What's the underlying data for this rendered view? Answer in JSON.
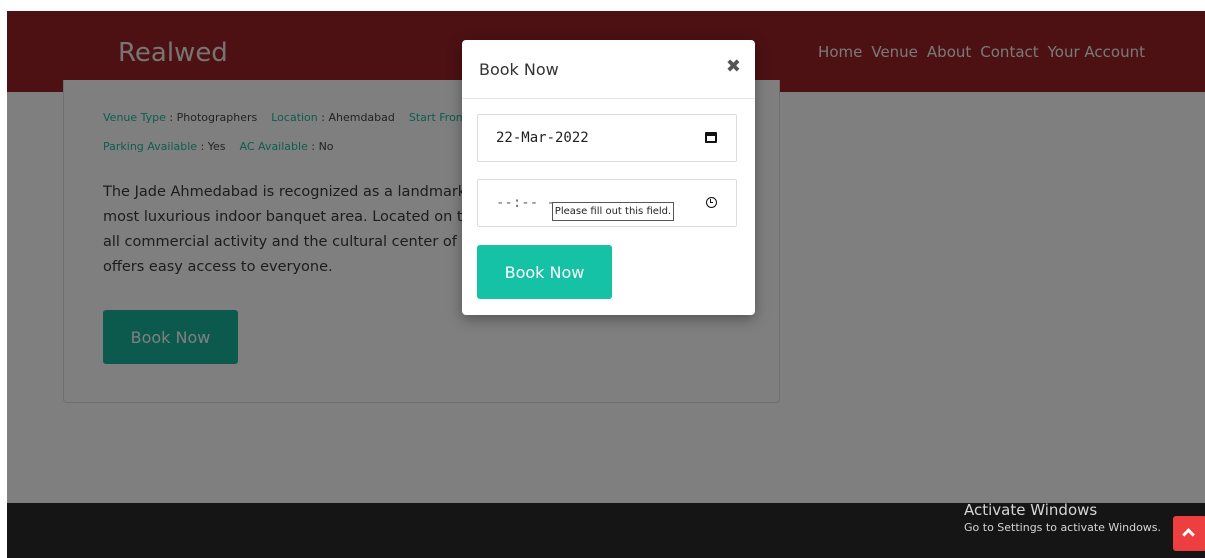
{
  "app": {
    "brand": "Realwed",
    "nav": [
      "Home",
      "Venue",
      "About",
      "Contact",
      "Your Account"
    ]
  },
  "venue": {
    "meta_line1": [
      {
        "k": "Venue Type",
        "v": "Photographers"
      },
      {
        "k": "Location",
        "v": "Ahemdabad"
      },
      {
        "k": "Start From",
        "v": ""
      }
    ],
    "meta_line2": [
      {
        "k": "Parking Available",
        "v": "Yes"
      },
      {
        "k": "AC Available",
        "v": "No"
      }
    ],
    "description_lines": [
      "The Jade Ahmedabad is recognized as a landmark",
      "most luxurious indoor banquet area. Located on t",
      "all commercial activity and the cultural center of",
      "offers easy access to everyone."
    ],
    "book_label": "Book Now"
  },
  "modal": {
    "title": "Book Now",
    "close_glyph": "✖",
    "date_value": "22-Mar-2022",
    "time_value": "--:-- --",
    "tooltip": "Please fill out this field.",
    "book_label": "Book Now"
  },
  "windows_watermark": {
    "line1": "Activate Windows",
    "line2": "Go to Settings to activate Windows."
  },
  "icons": {
    "calendar": "calendar-icon",
    "clock": "clock-icon",
    "close": "close-icon",
    "scroll_up": "chevron-up-icon"
  },
  "colors": {
    "navbar": "#9a2226",
    "accent": "#16c2a6",
    "footer": "#2a2a2c",
    "scroll_top": "#ed3f3f"
  }
}
